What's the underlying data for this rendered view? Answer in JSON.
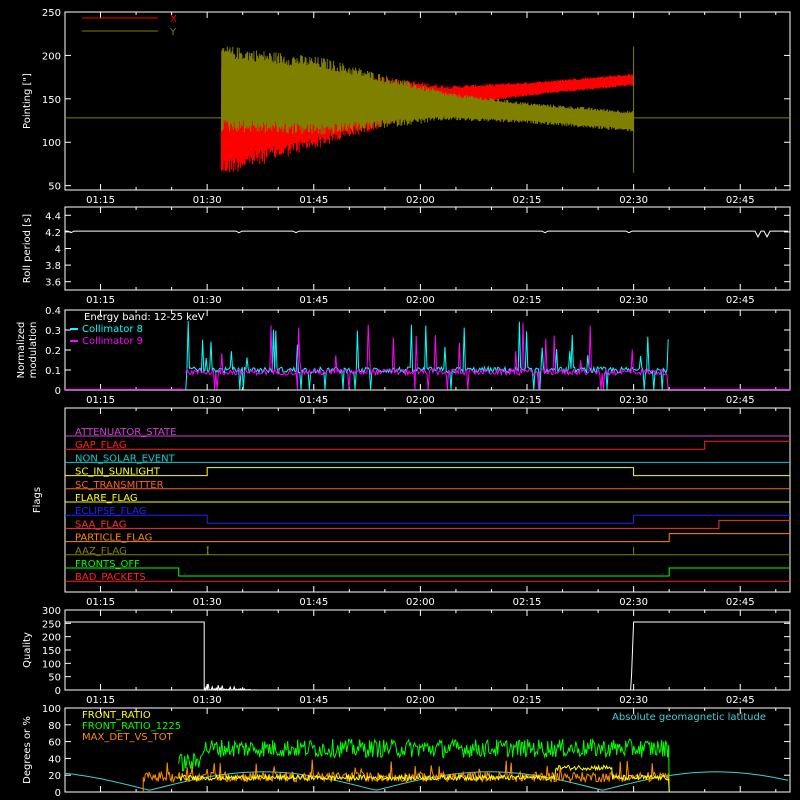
{
  "colors": {
    "background": "#000000",
    "axis": "#ffffff",
    "x_series": "#ff0000",
    "y_series": "#808000",
    "collimator8": "#00ffff",
    "collimator9": "#ff00ff",
    "latitude": "#40d0d0",
    "front_ratio": "#ffff00",
    "front_ratio_1225": "#00ff00",
    "max_det_vs_tot": "#ff8c00"
  },
  "time_ticks": [
    "01:15",
    "01:30",
    "01:45",
    "02:00",
    "02:15",
    "02:30",
    "02:45"
  ],
  "chart_data": [
    {
      "type": "line",
      "name": "pointing",
      "ylabel": "Pointing [\"]",
      "ylim": [
        45,
        250
      ],
      "yticks": [
        50,
        100,
        150,
        200,
        250
      ],
      "legend": [
        "X",
        "Y"
      ],
      "legend_position": "top-left",
      "time_range": [
        "01:10",
        "02:52"
      ],
      "series": [
        {
          "name": "X",
          "mean_start": 130,
          "mean_end": 172,
          "envelope": [
            [
              0,
              70
            ],
            [
              0.25,
              45
            ],
            [
              0.55,
              12
            ],
            [
              0.75,
              8
            ],
            [
              1,
              7
            ]
          ]
        },
        {
          "name": "Y",
          "mean_start": 162,
          "mean_end": 124,
          "envelope": [
            [
              0,
              50
            ],
            [
              0.25,
              45
            ],
            [
              0.55,
              16
            ],
            [
              0.75,
              12
            ],
            [
              1,
              12
            ]
          ]
        }
      ],
      "active_range": [
        "01:32",
        "02:30"
      ],
      "baseline": 128
    },
    {
      "type": "line",
      "name": "roll-period",
      "ylabel": "Roll period [s]",
      "ylim": [
        3.5,
        4.5
      ],
      "yticks": [
        3.6,
        3.8,
        4.0,
        4.2,
        4.4
      ],
      "series": [
        {
          "name": "roll",
          "value": 4.21
        }
      ]
    },
    {
      "type": "line",
      "name": "modulation",
      "ylabel": [
        "Normalized",
        "modulation"
      ],
      "ylim": [
        0,
        0.4
      ],
      "yticks": [
        0.0,
        0.1,
        0.2,
        0.3,
        0.4
      ],
      "annotation": "Energy band: 12-25 keV",
      "legend": [
        "Collimator 8",
        "Collimator 9"
      ],
      "legend_position": "top-left",
      "active_range": [
        "01:27",
        "02:35"
      ],
      "series": [
        {
          "name": "Collimator 8",
          "base": 0.1
        },
        {
          "name": "Collimator 9",
          "base": 0.09
        }
      ]
    },
    {
      "type": "step",
      "name": "flags",
      "ylabel": "Flags",
      "series": [
        {
          "name": "ATTENUATOR_STATE",
          "color": "#d040d0",
          "steps": []
        },
        {
          "name": "GAP_FLAG",
          "color": "#ff2020",
          "steps": [
            [
              "02:40",
              1
            ]
          ]
        },
        {
          "name": "NON_SOLAR_EVENT",
          "color": "#00d0d0",
          "steps": []
        },
        {
          "name": "SC_IN_SUNLIGHT",
          "color": "#ffff00",
          "steps": [
            [
              "01:30",
              1
            ],
            [
              "02:30",
              0
            ]
          ]
        },
        {
          "name": "SC_TRANSMITTER",
          "color": "#ff6020",
          "steps": []
        },
        {
          "name": "FLARE_FLAG",
          "color": "#ffff00",
          "steps": []
        },
        {
          "name": "ECLIPSE_FLAG",
          "color": "#2020ff",
          "steps": [
            [
              "01:30",
              -1
            ],
            [
              "02:30",
              0
            ]
          ]
        },
        {
          "name": "SAA_FLAG",
          "color": "#ff3030",
          "steps": [
            [
              "02:42",
              1
            ]
          ]
        },
        {
          "name": "PARTICLE_FLAG",
          "color": "#ff8c00",
          "steps": [
            [
              "02:35",
              1
            ]
          ]
        },
        {
          "name": "AAZ_FLAG",
          "color": "#808000",
          "steps": [
            [
              "01:30",
              1
            ],
            [
              "01:30",
              0
            ],
            [
              "02:30",
              1
            ],
            [
              "02:30",
              0
            ]
          ]
        },
        {
          "name": "FRONTS_OFF",
          "color": "#00ff00",
          "steps": [
            [
              "01:26",
              -1
            ],
            [
              "02:35",
              0
            ]
          ]
        },
        {
          "name": "BAD_PACKETS",
          "color": "#ff2020",
          "steps": []
        }
      ]
    },
    {
      "type": "line",
      "name": "quality",
      "ylabel": "Quality",
      "ylim": [
        0,
        300
      ],
      "yticks": [
        0,
        50,
        100,
        150,
        200,
        250,
        300
      ],
      "series": [
        {
          "name": "quality",
          "high": 255,
          "drop": "01:30",
          "rise": "02:30"
        }
      ]
    },
    {
      "type": "line",
      "name": "ratios",
      "ylabel": "Degrees or %",
      "ylim": [
        0,
        100
      ],
      "yticks": [
        0,
        20,
        40,
        60,
        80,
        100
      ],
      "legend": [
        "FRONT_RATIO",
        "FRONT_RATIO_1225",
        "MAX_DET_VS_TOT"
      ],
      "legend_position": "top-left",
      "right_label": "Absolute geomagnetic latitude",
      "series": [
        {
          "name": "FRONT_RATIO",
          "base": 17
        },
        {
          "name": "FRONT_RATIO_1225",
          "base": 52
        },
        {
          "name": "MAX_DET_VS_TOT",
          "base": 18
        },
        {
          "name": "Absolute geomagnetic latitude",
          "base": 20
        }
      ]
    }
  ]
}
